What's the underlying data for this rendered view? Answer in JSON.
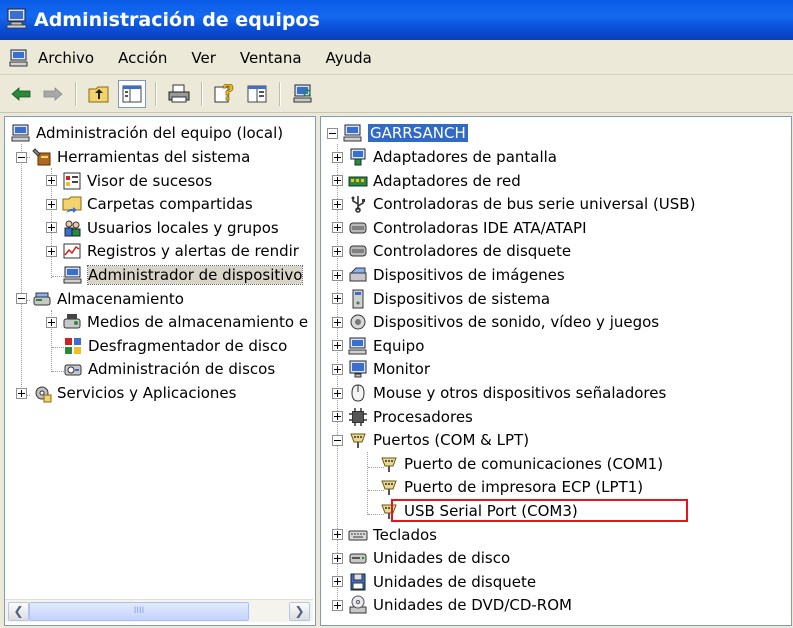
{
  "window": {
    "title": "Administración de equipos"
  },
  "menu": [
    "Archivo",
    "Acción",
    "Ver",
    "Ventana",
    "Ayuda"
  ],
  "toolbar": [
    "back-arrow-icon",
    "forward-arrow-icon",
    "up-folder-icon",
    "show-hide-tree-icon",
    "print-icon",
    "help-icon",
    "properties-icon",
    "scan-hardware-icon"
  ],
  "left_tree": {
    "root": "Administración del equipo (local)",
    "items": [
      {
        "label": "Herramientas del sistema",
        "level": 1,
        "expander": "minus",
        "icon": "tools-icon"
      },
      {
        "label": "Visor de sucesos",
        "level": 2,
        "expander": "plus",
        "icon": "event-viewer-icon"
      },
      {
        "label": "Carpetas compartidas",
        "level": 2,
        "expander": "plus",
        "icon": "shared-folder-icon"
      },
      {
        "label": "Usuarios locales y grupos",
        "level": 2,
        "expander": "plus",
        "icon": "users-icon"
      },
      {
        "label": "Registros y alertas de rendir",
        "level": 2,
        "expander": "plus",
        "icon": "performance-icon"
      },
      {
        "label": "Administrador de dispositivo",
        "level": 2,
        "expander": "none",
        "icon": "computer-icon",
        "selected": true
      },
      {
        "label": "Almacenamiento",
        "level": 1,
        "expander": "minus",
        "icon": "storage-icon"
      },
      {
        "label": "Medios de almacenamiento e",
        "level": 2,
        "expander": "plus",
        "icon": "removable-storage-icon"
      },
      {
        "label": "Desfragmentador de disco",
        "level": 2,
        "expander": "none",
        "icon": "defrag-icon"
      },
      {
        "label": "Administración de discos",
        "level": 2,
        "expander": "none",
        "icon": "disk-management-icon"
      },
      {
        "label": "Servicios y Aplicaciones",
        "level": 1,
        "expander": "plus",
        "icon": "services-icon"
      }
    ]
  },
  "right_tree": {
    "root": "GARRSANCH",
    "items": [
      {
        "label": "Adaptadores de pantalla",
        "level": 1,
        "expander": "plus",
        "icon": "display-adapter-icon"
      },
      {
        "label": "Adaptadores de red",
        "level": 1,
        "expander": "plus",
        "icon": "network-adapter-icon"
      },
      {
        "label": "Controladoras de bus serie universal (USB)",
        "level": 1,
        "expander": "plus",
        "icon": "usb-icon"
      },
      {
        "label": "Controladoras IDE ATA/ATAPI",
        "level": 1,
        "expander": "plus",
        "icon": "ide-controller-icon"
      },
      {
        "label": "Controladores de disquete",
        "level": 1,
        "expander": "plus",
        "icon": "floppy-controller-icon"
      },
      {
        "label": "Dispositivos de imágenes",
        "level": 1,
        "expander": "plus",
        "icon": "imaging-device-icon"
      },
      {
        "label": "Dispositivos de sistema",
        "level": 1,
        "expander": "plus",
        "icon": "system-device-icon"
      },
      {
        "label": "Dispositivos de sonido, vídeo y juegos",
        "level": 1,
        "expander": "plus",
        "icon": "sound-device-icon"
      },
      {
        "label": "Equipo",
        "level": 1,
        "expander": "plus",
        "icon": "computer-icon"
      },
      {
        "label": "Monitor",
        "level": 1,
        "expander": "plus",
        "icon": "monitor-icon"
      },
      {
        "label": "Mouse y otros dispositivos señaladores",
        "level": 1,
        "expander": "plus",
        "icon": "mouse-icon"
      },
      {
        "label": "Procesadores",
        "level": 1,
        "expander": "plus",
        "icon": "processor-icon"
      },
      {
        "label": "Puertos (COM & LPT)",
        "level": 1,
        "expander": "minus",
        "icon": "port-icon"
      },
      {
        "label": "Puerto de comunicaciones (COM1)",
        "level": 2,
        "expander": "none",
        "icon": "port-icon"
      },
      {
        "label": "Puerto de impresora ECP (LPT1)",
        "level": 2,
        "expander": "none",
        "icon": "port-icon"
      },
      {
        "label": "USB Serial Port (COM3)",
        "level": 2,
        "expander": "none",
        "icon": "port-icon",
        "highlighted": true
      },
      {
        "label": "Teclados",
        "level": 1,
        "expander": "plus",
        "icon": "keyboard-icon"
      },
      {
        "label": "Unidades de disco",
        "level": 1,
        "expander": "plus",
        "icon": "disk-drive-icon"
      },
      {
        "label": "Unidades de disquete",
        "level": 1,
        "expander": "plus",
        "icon": "floppy-drive-icon"
      },
      {
        "label": "Unidades de DVD/CD-ROM",
        "level": 1,
        "expander": "plus",
        "icon": "dvd-drive-icon"
      }
    ]
  },
  "scrollbar": {
    "grip": "IIII"
  },
  "colors": {
    "title_bar": "#0a5ce6",
    "selection": "#316ac5",
    "highlight_box": "#e8141c"
  }
}
